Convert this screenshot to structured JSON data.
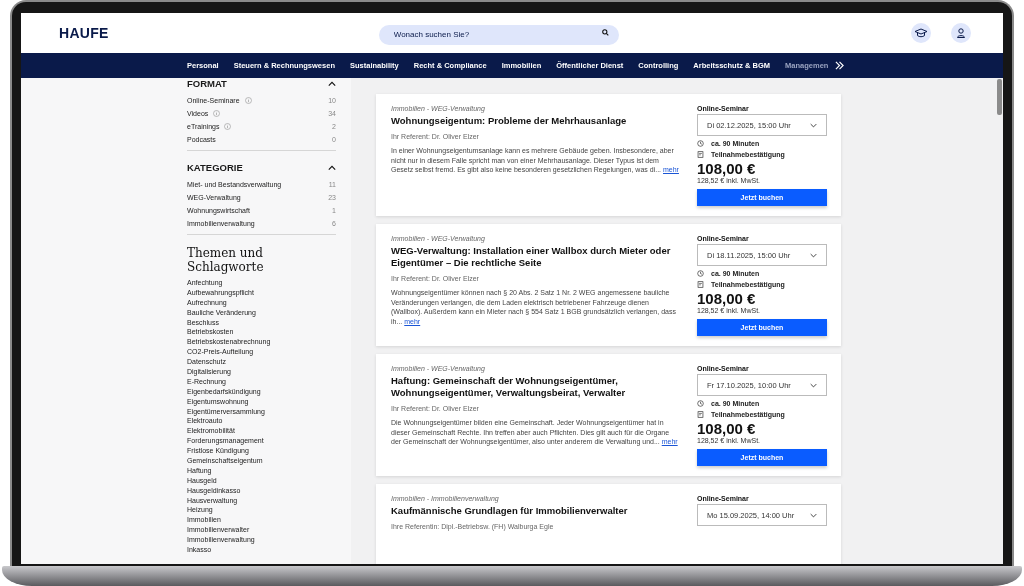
{
  "header": {
    "logo": "HAUFE",
    "search": {
      "placeholder": "Wonach suchen Sie?"
    }
  },
  "nav": {
    "items": [
      {
        "label": "Personal",
        "cut": false
      },
      {
        "label": "Steuern & Rechnungswesen",
        "cut": false
      },
      {
        "label": "Sustainability",
        "cut": false
      },
      {
        "label": "Recht & Compliance",
        "cut": false
      },
      {
        "label": "Immobilien",
        "cut": false
      },
      {
        "label": "Öffentlicher Dienst",
        "cut": false
      },
      {
        "label": "Controlling",
        "cut": false
      },
      {
        "label": "Arbeitsschutz & BGM",
        "cut": false
      },
      {
        "label": "Managemen",
        "cut": true
      }
    ]
  },
  "sidebar": {
    "sections": [
      {
        "title": "FORMAT",
        "expanded": true,
        "items": [
          {
            "label": "Online-Seminare",
            "info": true,
            "count": "10"
          },
          {
            "label": "Videos",
            "info": true,
            "count": "34"
          },
          {
            "label": "eTrainings",
            "info": true,
            "count": "2"
          },
          {
            "label": "Podcasts",
            "info": false,
            "count": "0"
          }
        ]
      },
      {
        "title": "KATEGORIE",
        "expanded": true,
        "items": [
          {
            "label": "Miet- und Bestandsverwaltung",
            "info": false,
            "count": "11"
          },
          {
            "label": "WEG-Verwaltung",
            "info": false,
            "count": "23"
          },
          {
            "label": "Wohnungswirtschaft",
            "info": false,
            "count": "1"
          },
          {
            "label": "Immobilienverwaltung",
            "info": false,
            "count": "6"
          }
        ]
      }
    ],
    "topics_title": "Themen und Schlagworte",
    "topics": [
      "Anfechtung",
      "Aufbewahrungspflicht",
      "Aufrechnung",
      "Bauliche Veränderung",
      "Beschluss",
      "Betriebskosten",
      "Betriebskostenabrechnung",
      "CO2-Preis-Aufteilung",
      "Datenschutz",
      "Digitalisierung",
      "E-Rechnung",
      "Eigenbedarfskündigung",
      "Eigentumswohnung",
      "Eigentümerversammlung",
      "Elektroauto",
      "Elektromobilität",
      "Forderungsmanagement",
      "Fristlose Kündigung",
      "Gemeinschaftseigentum",
      "Haftung",
      "Hausgeld",
      "Hausgeldinkasso",
      "Hausverwaltung",
      "Heizung",
      "Immobilien",
      "Immobilienverwalter",
      "Immobilienverwaltung",
      "Inkasso"
    ]
  },
  "cards": [
    {
      "breadcrumb": "Immobilien - WEG-Verwaltung",
      "title": "Wohnungseigentum: Probleme der Mehrhausanlage",
      "referent": "Ihr Referent: Dr. Oliver Elzer",
      "teaser": "In einer Wohnungseigentumsanlage kann es mehrere Gebäude geben. Insbesondere, aber nicht nur in diesem Falle spricht man von einer Mehrhausanlage. Dieser Typus ist dem Gesetz selbst fremd. Es gibt also keine besonderen gesetzlichen Regelungen, was di...",
      "more": "mehr",
      "format": "Online-Seminar",
      "date": "Di 02.12.2025, 15:00 Uhr",
      "duration": "ca. 90 Minuten",
      "certificate": "Teilnahmebestätigung",
      "price": "108,00 €",
      "price_gross": "128,52 € inkl. MwSt.",
      "button": "Jetzt buchen"
    },
    {
      "breadcrumb": "Immobilien - WEG-Verwaltung",
      "title": "WEG-Verwaltung: Installation einer Wallbox durch Mieter oder Eigentümer – Die rechtliche Seite",
      "referent": "Ihr Referent: Dr. Oliver Elzer",
      "teaser": "Wohnungseigentümer können nach § 20 Abs. 2 Satz 1 Nr. 2 WEG angemessene bauliche Veränderungen verlangen, die dem Laden elektrisch betriebener Fahrzeuge dienen (Wallbox). Außerdem kann ein Mieter nach § 554 Satz 1 BGB grundsätzlich verlangen, dass ih...",
      "more": "mehr",
      "format": "Online-Seminar",
      "date": "Di 18.11.2025, 15:00 Uhr",
      "duration": "ca. 90 Minuten",
      "certificate": "Teilnahmebestätigung",
      "price": "108,00 €",
      "price_gross": "128,52 € inkl. MwSt.",
      "button": "Jetzt buchen"
    },
    {
      "breadcrumb": "Immobilien - WEG-Verwaltung",
      "title": "Haftung: Gemeinschaft der Wohnungseigentümer, Wohnungseigentümer, Verwaltungsbeirat, Verwalter",
      "referent": "Ihr Referent: Dr. Oliver Elzer",
      "teaser": "Die Wohnungseigentümer bilden eine Gemeinschaft. Jeder Wohnungseigentümer hat in dieser Gemeinschaft Rechte. Ihn treffen aber auch Pflichten. Dies gilt auch für die Organe der Gemeinschaft der Wohnungseigentümer, also unter anderem die Verwaltung und...",
      "more": "mehr",
      "format": "Online-Seminar",
      "date": "Fr 17.10.2025, 10:00 Uhr",
      "duration": "ca. 90 Minuten",
      "certificate": "Teilnahmebestätigung",
      "price": "108,00 €",
      "price_gross": "128,52 € inkl. MwSt.",
      "button": "Jetzt buchen"
    },
    {
      "breadcrumb": "Immobilien - Immobilienverwaltung",
      "title": "Kaufmännische Grundlagen für Immobilienverwalter",
      "referent": "Ihre Referentin: Dipl.-Betriebsw. (FH) Walburga Egle",
      "format": "Online-Seminar",
      "date": "Mo 15.09.2025, 14:00 Uhr"
    }
  ]
}
